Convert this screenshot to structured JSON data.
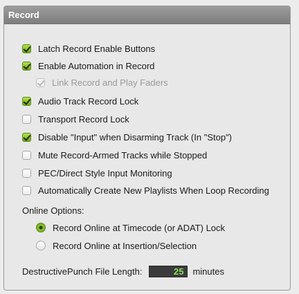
{
  "panel": {
    "title": "Record"
  },
  "options": [
    {
      "label": "Latch Record Enable Buttons",
      "checked": true,
      "disabled": false,
      "indent": false
    },
    {
      "label": "Enable Automation in Record",
      "checked": true,
      "disabled": false,
      "indent": false
    },
    {
      "label": "Link Record and Play Faders",
      "checked": true,
      "disabled": true,
      "indent": true
    },
    {
      "label": "Audio Track Record Lock",
      "checked": true,
      "disabled": false,
      "indent": false
    },
    {
      "label": "Transport Record Lock",
      "checked": false,
      "disabled": false,
      "indent": false
    },
    {
      "label": "Disable \"Input\" when Disarming Track (In \"Stop\")",
      "checked": true,
      "disabled": false,
      "indent": false
    },
    {
      "label": "Mute Record-Armed Tracks while Stopped",
      "checked": false,
      "disabled": false,
      "indent": false
    },
    {
      "label": "PEC/Direct Style Input Monitoring",
      "checked": false,
      "disabled": false,
      "indent": false
    },
    {
      "label": "Automatically Create New Playlists When Loop Recording",
      "checked": false,
      "disabled": false,
      "indent": false
    }
  ],
  "online_options": {
    "label": "Online Options:",
    "choices": [
      {
        "label": "Record Online at Timecode (or ADAT) Lock",
        "selected": true
      },
      {
        "label": "Record Online at Insertion/Selection",
        "selected": false
      }
    ]
  },
  "punch": {
    "label": "DestructivePunch File Length:",
    "value": "25",
    "unit": "minutes"
  },
  "colors": {
    "header_bg": "#8a8a8a",
    "check_green": "#7cb722",
    "field_text": "#86e25a"
  }
}
